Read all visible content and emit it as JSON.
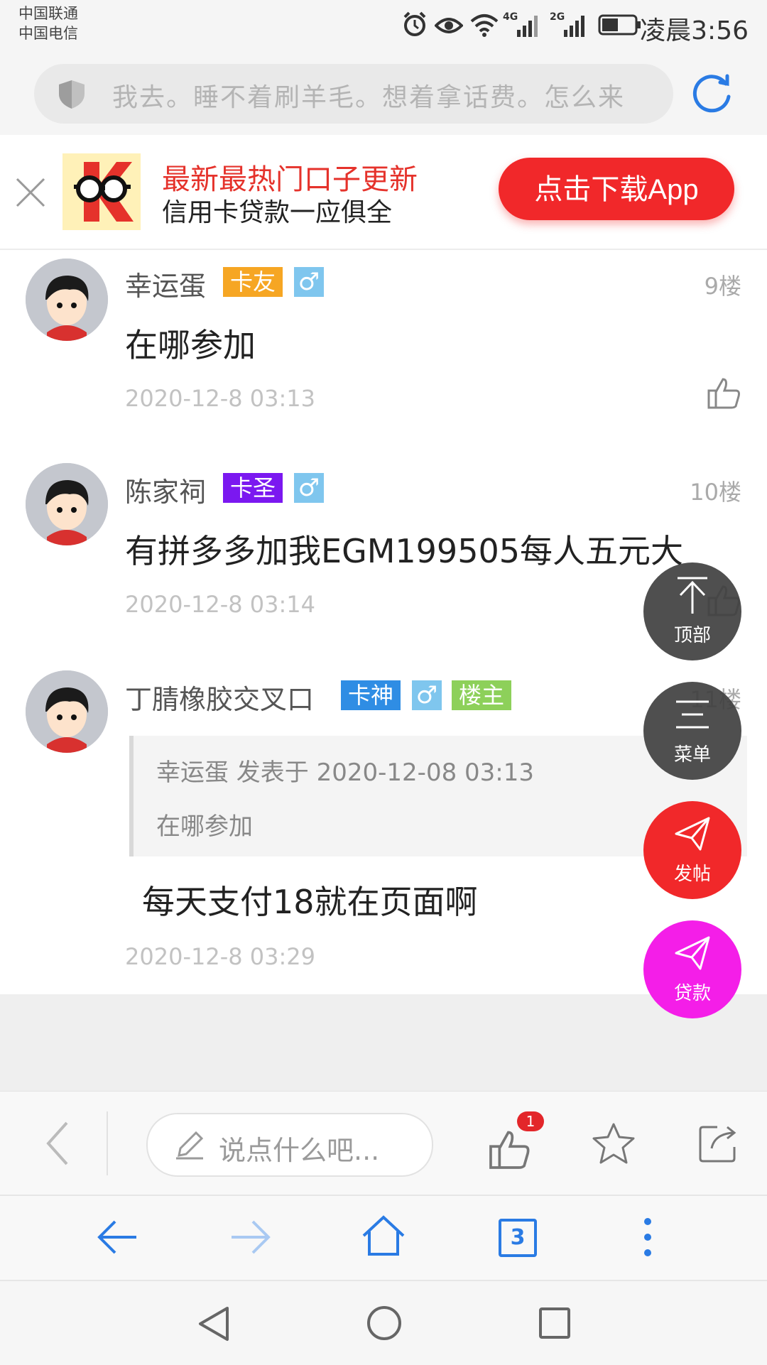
{
  "status_bar": {
    "carrier1": "中国联通",
    "carrier2": "中国电信",
    "network1": "4G",
    "network2": "2G",
    "time": "凌晨3:56"
  },
  "address_bar": {
    "url_text": "我去。睡不着刷羊毛。想着拿话费。怎么来"
  },
  "banner": {
    "title": "最新最热门口子更新",
    "subtitle": "信用卡贷款一应俱全",
    "download_label": "点击下载App"
  },
  "posts": [
    {
      "username": "幸运蛋",
      "badge": "卡友",
      "badge_color": "#f6a623",
      "gender": "♂",
      "floor": "9楼",
      "content": "在哪参加",
      "time": "2020-12-8 03:13"
    },
    {
      "username": "陈家祠",
      "badge": "卡圣",
      "badge_color": "#7b18f0",
      "gender": "♂",
      "floor": "10楼",
      "content": "有拼多多加我EGM199505每人五元大",
      "time": "2020-12-8 03:14"
    },
    {
      "username": "丁腈橡胶交叉口",
      "badge": "卡神",
      "badge_color": "#2f8de4",
      "gender": "♂",
      "owner_badge": "楼主",
      "owner_badge_color": "#8dd05a",
      "floor": "11楼",
      "quote_header": "幸运蛋 发表于 2020-12-08 03:13",
      "quote_text": "在哪参加",
      "content": "每天支付18就在页面啊",
      "time": "2020-12-8 03:29"
    }
  ],
  "fabs": {
    "top": "顶部",
    "menu": "菜单",
    "post": "发帖",
    "loan": "贷款"
  },
  "colors": {
    "accent_blue": "#2a7be4",
    "fab_dark": "#4a4a4a",
    "fab_red": "#f1282a",
    "fab_magenta": "#f41ee8"
  },
  "comment_bar": {
    "placeholder": "说点什么吧...",
    "like_count": "1"
  },
  "browser_nav": {
    "tab_count": "3"
  }
}
